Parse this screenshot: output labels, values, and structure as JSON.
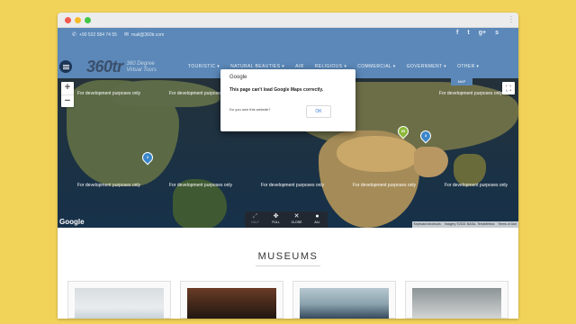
{
  "topbar": {
    "phone": "+90 532 584 74 55",
    "email": "mail@360tr.com",
    "social": [
      "f",
      "t",
      "g+",
      "s"
    ]
  },
  "logo": {
    "mark": "360tr",
    "line1": "360 Degree",
    "line2": "Virtual Tours"
  },
  "nav": {
    "items": [
      "TOURISTIC ▾",
      "NATURAL BEAUTIES ▾",
      "AIR",
      "RELIGIOUS ▾",
      "COMMERCIAL ▾",
      "GOVERNMENT ▾",
      "OTHER ▾"
    ]
  },
  "map": {
    "zoom_in": "+",
    "zoom_out": "−",
    "tag": "MAP",
    "dev_text": "For development purposes only",
    "markers": [
      "2",
      "53",
      "3"
    ],
    "google_logo": "Google",
    "attribution": [
      "Keyboard shortcuts",
      "Imagery ©2021 NASA, TerraMetrics",
      "Terms of Use"
    ],
    "controls": [
      {
        "icon": "⤢",
        "label": "HALF"
      },
      {
        "icon": "✥",
        "label": "FULL"
      },
      {
        "icon": "✕",
        "label": "CLOSE"
      },
      {
        "icon": "●",
        "label": "ALL"
      }
    ]
  },
  "dialog": {
    "title": "Google",
    "message": "This page can't load Google Maps correctly.",
    "link": "Do you own this website?",
    "ok": "OK"
  },
  "section": {
    "title": "MUSEUMS"
  },
  "colors": {
    "page_background": "#f2d35a",
    "header": "#5b88b8",
    "marker_blue": "#3a86c8",
    "marker_green": "#8cb83a"
  }
}
